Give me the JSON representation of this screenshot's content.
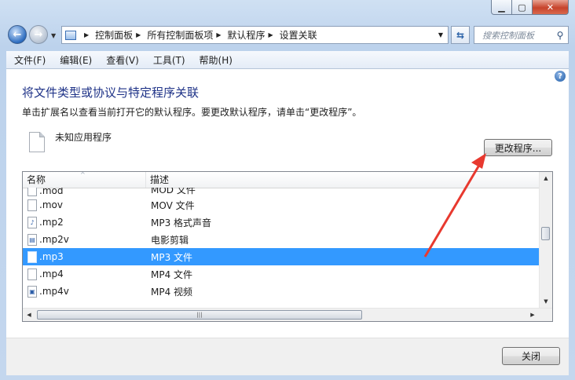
{
  "address": {
    "crumbs": [
      "控制面板",
      "所有控制面板项",
      "默认程序",
      "设置关联"
    ]
  },
  "search": {
    "placeholder": "搜索控制面板"
  },
  "menu": [
    "文件(F)",
    "编辑(E)",
    "查看(V)",
    "工具(T)",
    "帮助(H)"
  ],
  "page": {
    "title": "将文件类型或协议与特定程序关联",
    "description": "单击扩展名以查看当前打开它的默认程序。要更改默认程序，请单击“更改程序”。",
    "current_app": "未知应用程序",
    "change_button": "更改程序..."
  },
  "list": {
    "columns": [
      "名称",
      "描述"
    ],
    "rows": [
      {
        "ext": ".mod",
        "desc": "MOD 文件",
        "icon": "blank-file-icon"
      },
      {
        "ext": ".mov",
        "desc": "MOV 文件",
        "icon": "blank-file-icon"
      },
      {
        "ext": ".mp2",
        "desc": "MP3 格式声音",
        "icon": "audio-file-icon"
      },
      {
        "ext": ".mp2v",
        "desc": "电影剪辑",
        "icon": "video-file-icon"
      },
      {
        "ext": ".mp3",
        "desc": "MP3 文件",
        "icon": "blank-file-icon",
        "selected": true
      },
      {
        "ext": ".mp4",
        "desc": "MP4 文件",
        "icon": "blank-file-icon"
      },
      {
        "ext": ".mp4v",
        "desc": "MP4 视频",
        "icon": "media-file-icon"
      }
    ]
  },
  "footer": {
    "close_button": "关闭"
  },
  "colors": {
    "selection": "#3399ff",
    "annotation_arrow": "#e8392f",
    "title_text": "#1e3287"
  }
}
